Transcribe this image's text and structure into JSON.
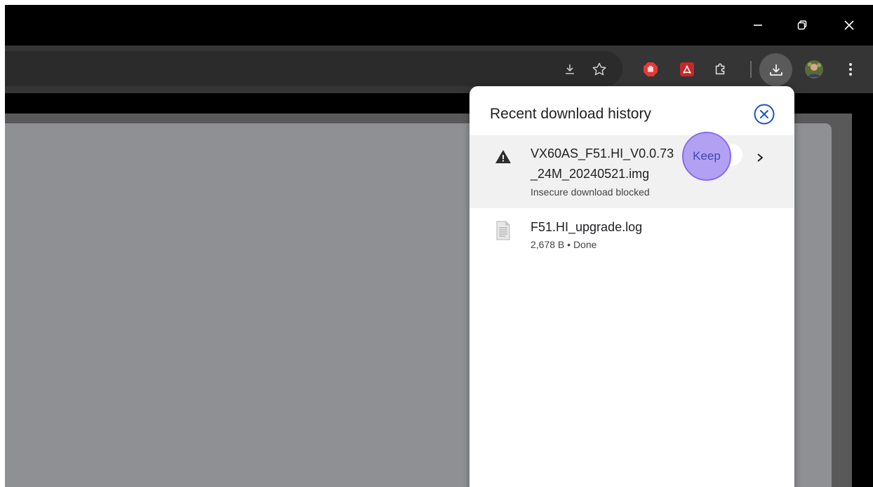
{
  "window": {
    "minimize_icon": "minimize-icon",
    "restore_icon": "restore-icon",
    "close_icon": "close-icon"
  },
  "toolbar": {
    "icons": [
      "install-app-icon",
      "bookmark-star-icon",
      "adblock-extension-icon",
      "acrobat-extension-icon",
      "extensions-puzzle-icon",
      "downloads-icon",
      "profile-avatar",
      "menu-dots-icon"
    ]
  },
  "downloads_bubble": {
    "title": "Recent download history",
    "items": [
      {
        "name_line1": "VX60AS_F51.HI_V0.0.73",
        "name_line2": "_24M_20240521.img",
        "status": "Insecure download blocked",
        "action": "Keep",
        "icon": "warning-icon"
      },
      {
        "name": "F51.HI_upgrade.log",
        "status": "2,678 B • Done",
        "icon": "file-icon"
      }
    ]
  },
  "colors": {
    "keep_highlight": "#b2a1f2",
    "keep_text": "#3d48b3",
    "close_icon": "#1a56c4",
    "adblock_red": "#e53935",
    "acrobat_red": "#c62828"
  }
}
